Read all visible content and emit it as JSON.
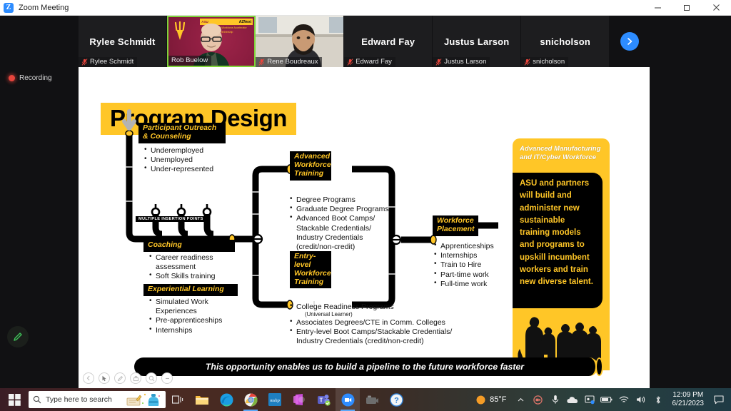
{
  "window": {
    "app_icon": "zoom-logo-icon",
    "title": "Zoom Meeting",
    "controls": {
      "minimize": "minimize-icon",
      "maximize": "maximize-icon",
      "close": "close-icon"
    }
  },
  "meeting": {
    "recording_label": "Recording",
    "annotate_icon": "pencil-icon",
    "next_page_icon": "chevron-right-icon",
    "participants": [
      {
        "display_name": "Rylee Schmidt",
        "label": "Rylee Schmidt",
        "muted": true,
        "video_on": false,
        "active_speaker": false
      },
      {
        "display_name": "Rob Buelow",
        "label": "Rob Buelow",
        "muted": false,
        "video_on": true,
        "active_speaker": true,
        "background_banner_left": "ASU",
        "background_banner_right": "AZNext",
        "background_subtitle": "Arizona Next Workforce Accelerator Partnership"
      },
      {
        "display_name": "Rene Boudreaux",
        "label": "Rene Boudreaux",
        "muted": true,
        "video_on": true,
        "active_speaker": false
      },
      {
        "display_name": "Edward Fay",
        "label": "Edward Fay",
        "muted": true,
        "video_on": false,
        "active_speaker": false
      },
      {
        "display_name": "Justus Larson",
        "label": "Justus Larson",
        "muted": true,
        "video_on": false,
        "active_speaker": false
      },
      {
        "display_name": "snicholson",
        "label": "snicholson",
        "muted": true,
        "video_on": false,
        "active_speaker": false
      }
    ]
  },
  "slide": {
    "title": "Program Design",
    "insertion_points_caption": "MULTIPLE INSERTION POINTS",
    "blocks": {
      "participant_outreach": {
        "heading": "Participant Outreach\n&  Counseling",
        "items": [
          "Underemployed",
          "Unemployed",
          "Under-represented"
        ]
      },
      "coaching": {
        "heading": "Coaching",
        "items": [
          "Career readiness assessment",
          "Soft Skills training"
        ]
      },
      "experiential_learning": {
        "heading": "Experiential Learning",
        "items": [
          "Simulated Work Experiences",
          "Pre-apprenticeships",
          "Internships"
        ]
      },
      "advanced_workforce_training": {
        "heading": "Advanced\nWorkforce\nTraining",
        "items": [
          "Degree Programs",
          "Graduate Degree Programs",
          "Advanced Boot Camps/ Stackable Credentials/ Industry Credentials (credit/non-credit)"
        ]
      },
      "entry_level_workforce_training": {
        "heading": "Entry-level\nWorkforce\nTraining",
        "items": [
          "College Readiness Programs",
          "Associates Degrees/CTE in Comm. Colleges",
          "Entry-level Boot Camps/Stackable Credentials/ Industry Credentials (credit/non-credit)"
        ],
        "sub_note": "(Universal Learner)"
      },
      "workforce_placement": {
        "heading": "Workforce\nPlacement",
        "items": [
          "Apprenticeships",
          "Internships",
          "Train to Hire",
          "Part-time work",
          "Full-time work"
        ]
      },
      "outcome_panel": {
        "heading": "Advanced Manufacturing and IT/Cyber Workforce",
        "body": "ASU and partners will build and administer new sustainable training models and programs to upskill incumbent workers and train new diverse talent."
      }
    },
    "banner": "This opportunity enables us to build a pipeline to the future workforce faster",
    "annotation_tools": [
      "previous-icon",
      "mouse-pointer-icon",
      "pen-icon",
      "stamp-icon",
      "spotlight-icon",
      "eraser-icon"
    ],
    "colors": {
      "accent_yellow": "#ffc627",
      "asu_maroon": "#8c1d40",
      "ink": "#000000"
    }
  },
  "taskbar": {
    "start_icon": "windows-start-icon",
    "search_placeholder": "Type here to search",
    "search_icon": "search-icon",
    "apps": [
      {
        "name": "task-view-icon"
      },
      {
        "name": "file-explorer-icon"
      },
      {
        "name": "microsoft-edge-icon"
      },
      {
        "name": "google-chrome-icon"
      },
      {
        "name": "mshp-app-icon"
      },
      {
        "name": "microsoft-365-icon"
      },
      {
        "name": "microsoft-teams-icon"
      },
      {
        "name": "zoom-app-icon"
      },
      {
        "name": "camera-app-icon"
      },
      {
        "name": "help-support-icon"
      }
    ],
    "tray": {
      "temperature": "85°F",
      "weather_icon": "sun-icon",
      "show_hidden_icons": "chevron-up-icon",
      "icons": [
        "zoom-tray-icon",
        "microphone-icon",
        "onedrive-icon",
        "display-icon",
        "battery-icon",
        "wifi-icon",
        "speaker-icon",
        "bluetooth-icon"
      ],
      "time": "12:09 PM",
      "date": "6/21/2023",
      "notification_icon": "notification-icon"
    }
  }
}
